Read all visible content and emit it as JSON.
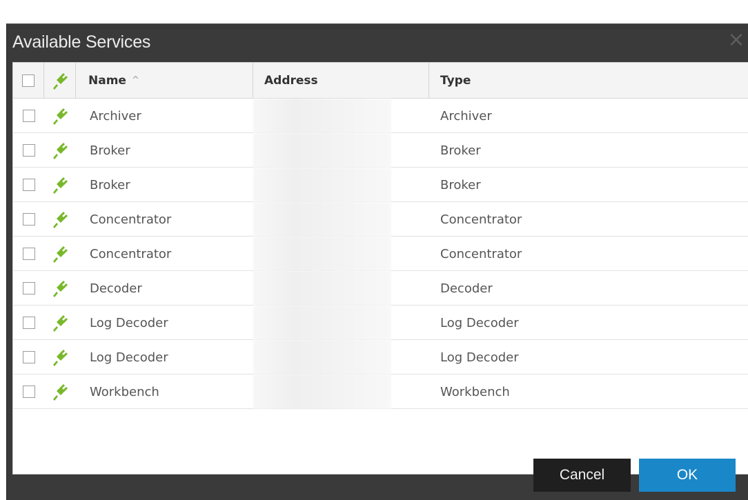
{
  "dialog": {
    "title": "Available Services",
    "close_icon": "close-icon"
  },
  "table": {
    "columns": [
      {
        "key": "select",
        "label": ""
      },
      {
        "key": "status",
        "label": "",
        "icon": "plug-icon"
      },
      {
        "key": "name",
        "label": "Name",
        "sort": "ascending"
      },
      {
        "key": "address",
        "label": "Address"
      },
      {
        "key": "type",
        "label": "Type"
      }
    ],
    "header": {
      "name_label": "Name",
      "sort_glyph": "^",
      "address_label": "Address",
      "type_label": "Type"
    },
    "rows": [
      {
        "name": "Archiver",
        "address": "",
        "type": "Archiver",
        "checked": false
      },
      {
        "name": "Broker",
        "address": "",
        "type": "Broker",
        "checked": false
      },
      {
        "name": "Broker",
        "address": "",
        "type": "Broker",
        "checked": false
      },
      {
        "name": "Concentrator",
        "address": "",
        "type": "Concentrator",
        "checked": false
      },
      {
        "name": "Concentrator",
        "address": "",
        "type": "Concentrator",
        "checked": false
      },
      {
        "name": "Decoder",
        "address": "",
        "type": "Decoder",
        "checked": false
      },
      {
        "name": "Log Decoder",
        "address": "",
        "type": "Log Decoder",
        "checked": false
      },
      {
        "name": "Log Decoder",
        "address": "",
        "type": "Log Decoder",
        "checked": false
      },
      {
        "name": "Workbench",
        "address": "",
        "type": "Workbench",
        "checked": false
      }
    ]
  },
  "buttons": {
    "cancel_label": "Cancel",
    "ok_label": "OK"
  },
  "colors": {
    "dialog_bg": "#3a3a3a",
    "plug_green": "#78b82a",
    "ok_blue": "#1a87c9",
    "cancel_bg": "#1f1f1f"
  }
}
